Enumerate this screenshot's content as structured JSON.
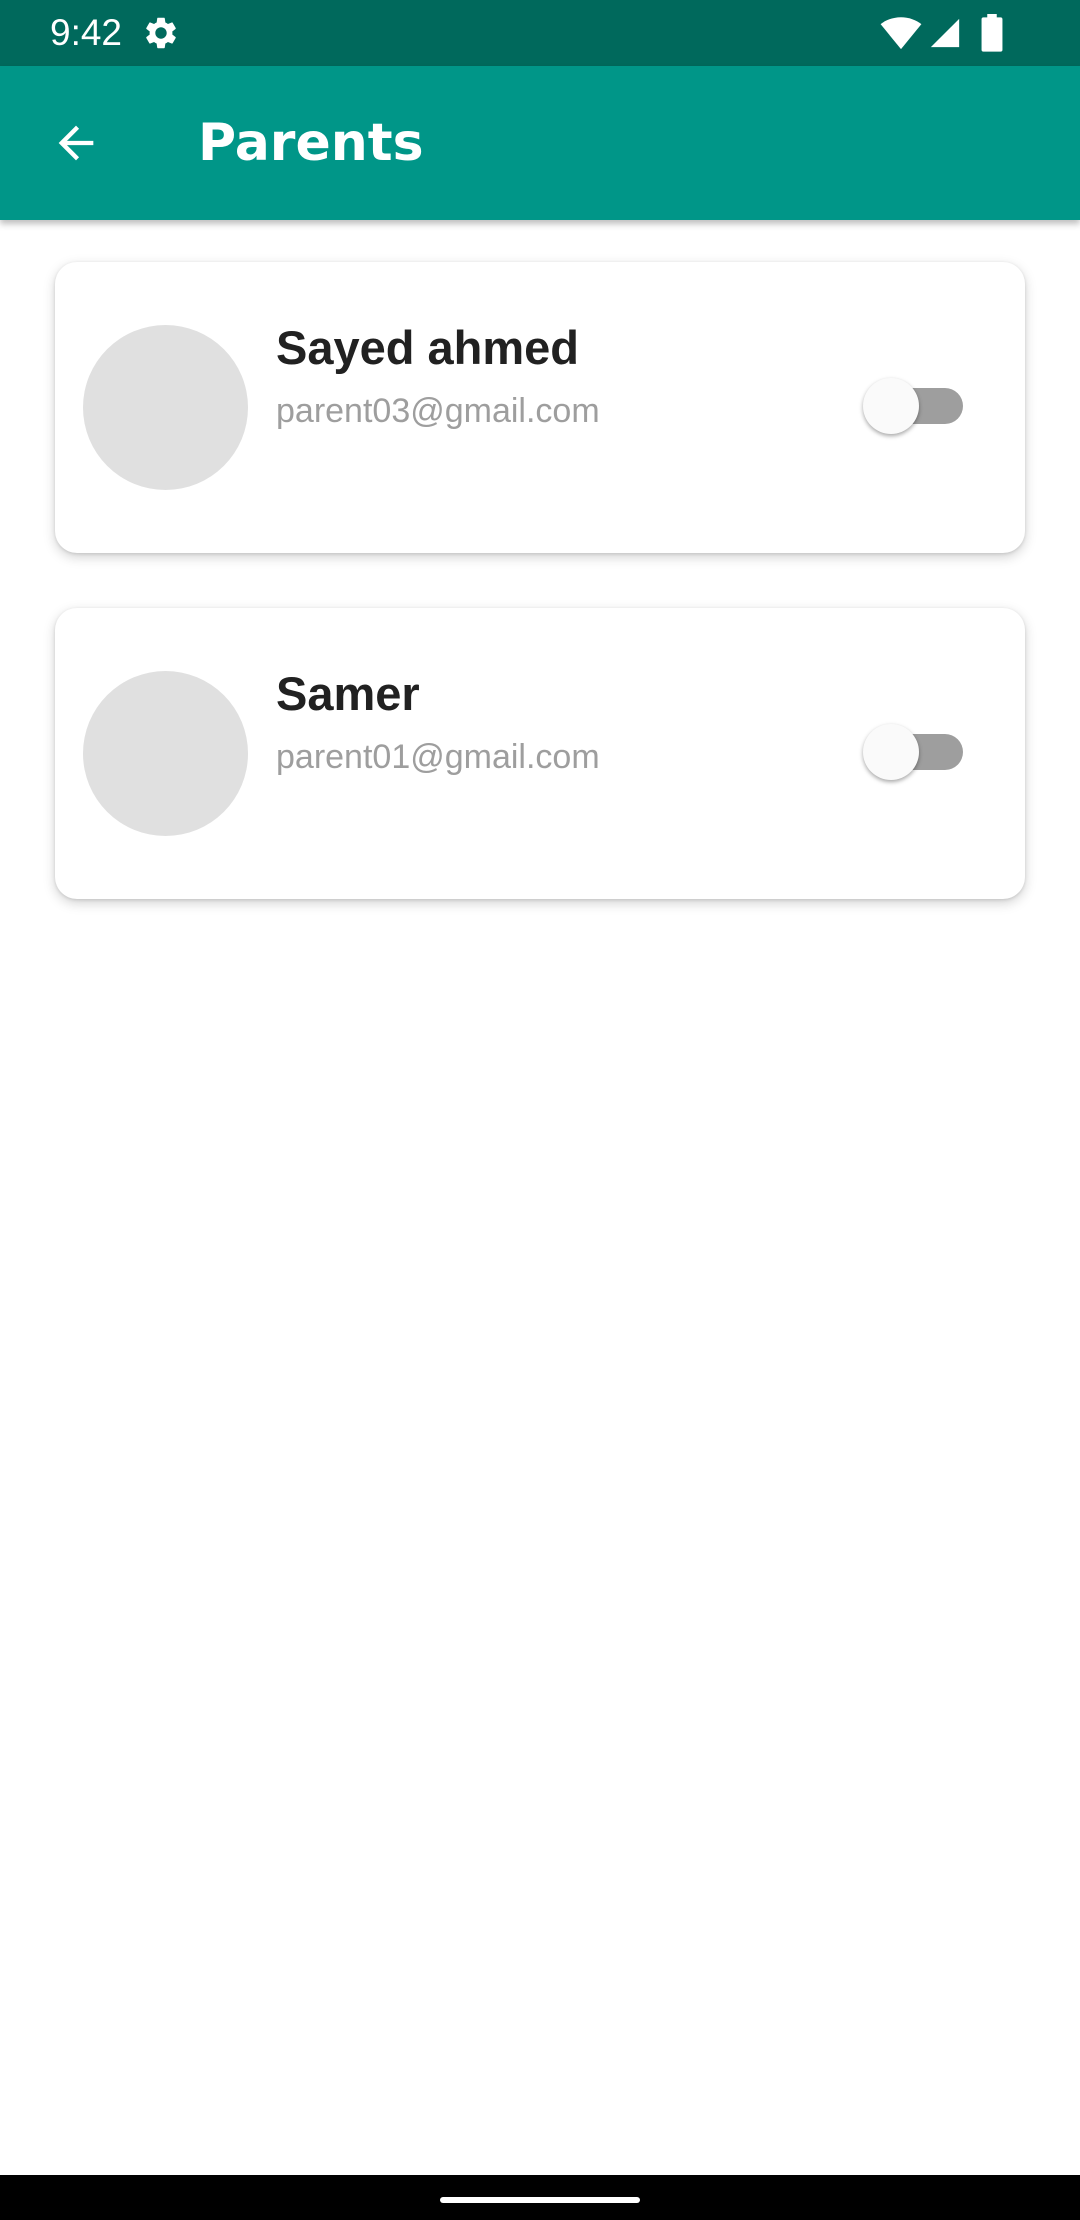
{
  "status_bar": {
    "time": "9:42",
    "icons": [
      "gear-icon",
      "wifi-icon",
      "signal-icon",
      "battery-icon"
    ]
  },
  "app_bar": {
    "title": "Parents",
    "back_icon": "arrow-left-icon",
    "color": "#009688"
  },
  "parents": [
    {
      "name": "Sayed ahmed",
      "email": "parent03@gmail.com",
      "toggle_on": false
    },
    {
      "name": "Samer",
      "email": "parent01@gmail.com",
      "toggle_on": false
    }
  ],
  "colors": {
    "status_bar": "#00695c",
    "app_bar": "#009688",
    "name_text": "#212121",
    "email_text": "#9e9e9e",
    "avatar": "#e0e0e0"
  }
}
